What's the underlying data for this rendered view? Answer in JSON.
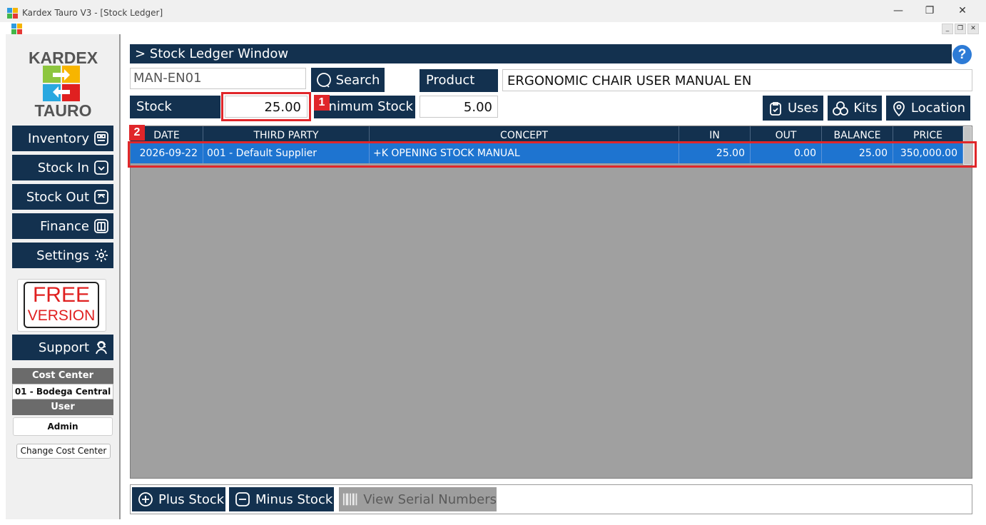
{
  "window": {
    "title": "Kardex Tauro V3 - [Stock Ledger]",
    "minimize_glyph": "—",
    "restore_glyph": "❐",
    "close_glyph": "✕",
    "mdi_min_glyph": "_",
    "mdi_restore_glyph": "❐",
    "mdi_close_glyph": "✕"
  },
  "logo": {
    "line1": "KARDEX",
    "line2": "TAURO"
  },
  "sidebar": {
    "nav": [
      {
        "label": "Inventory",
        "icon": "inventory-icon"
      },
      {
        "label": "Stock In",
        "icon": "stock-in-icon"
      },
      {
        "label": "Stock Out",
        "icon": "stock-out-icon"
      },
      {
        "label": "Finance",
        "icon": "book-icon"
      },
      {
        "label": "Settings",
        "icon": "gear-icon"
      }
    ],
    "free_badge": {
      "line1": "FREE",
      "line2": "VERSION"
    },
    "support": {
      "label": "Support",
      "icon": "support-agent-icon"
    },
    "cost_center_label": "Cost Center",
    "cost_center_value": "01 - Bodega Central",
    "user_label": "User",
    "user_value": "Admin",
    "change_cost_center": "Change Cost Center"
  },
  "header": {
    "title": "> Stock Ledger Window",
    "help_glyph": "?"
  },
  "form": {
    "code_value": "MAN-EN01",
    "search_label": "Search",
    "product_label": "Product",
    "product_value": "ERGONOMIC CHAIR USER MANUAL EN",
    "stock_label": "Stock",
    "stock_value": "25.00",
    "min_stock_label": "Minimum Stock",
    "min_stock_value": "5.00",
    "uses_label": "Uses",
    "kits_label": "Kits",
    "location_label": "Location"
  },
  "annotations": {
    "badge1": "1",
    "badge2": "2"
  },
  "table": {
    "columns": [
      "DATE",
      "THIRD PARTY",
      "CONCEPT",
      "IN",
      "OUT",
      "BALANCE",
      "PRICE"
    ],
    "rows": [
      [
        "2026-09-22",
        "001 - Default Supplier",
        "+K OPENING STOCK MANUAL",
        "25.00",
        "0.00",
        "25.00",
        "350,000.00"
      ]
    ]
  },
  "footer": {
    "plus_stock": "Plus Stock",
    "minus_stock": "Minus Stock",
    "view_serials": "View Serial Numbers"
  },
  "colors": {
    "navy": "#13314f",
    "selected_row": "#1e74d0",
    "highlight_red": "#e0262a",
    "grid_background": "#a0a0a0",
    "free_red": "#e02020"
  }
}
